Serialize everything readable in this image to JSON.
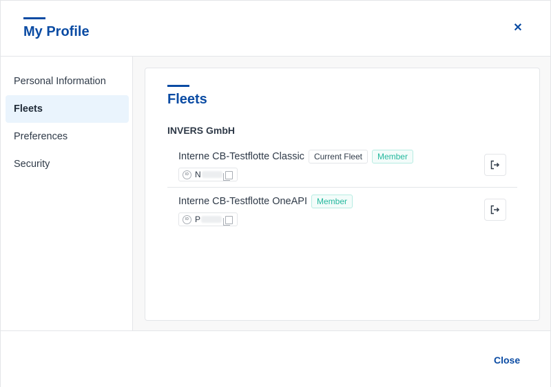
{
  "header": {
    "title": "My Profile",
    "close_icon": "close-icon",
    "close_glyph": "✕"
  },
  "sidebar": {
    "items": [
      {
        "label": "Personal Information",
        "active": false
      },
      {
        "label": "Fleets",
        "active": true
      },
      {
        "label": "Preferences",
        "active": false
      },
      {
        "label": "Security",
        "active": false
      }
    ]
  },
  "main": {
    "section_title": "Fleets",
    "organization": "INVERS GmbH",
    "fleets": [
      {
        "name": "Interne CB-Testflotte Classic",
        "badges": [
          "Current Fleet",
          "Member"
        ],
        "id_prefix": "N",
        "id_icon": "id-icon",
        "copy_icon": "copy-icon",
        "action_icon": "leave-fleet-icon"
      },
      {
        "name": "Interne CB-Testflotte OneAPI",
        "badges": [
          "Member"
        ],
        "id_prefix": "P",
        "id_icon": "id-icon",
        "copy_icon": "copy-icon",
        "action_icon": "leave-fleet-icon"
      }
    ],
    "id_icon_text": "ID"
  },
  "footer": {
    "close_label": "Close"
  },
  "colors": {
    "accent": "#0a4ba3",
    "member": "#23b89d",
    "active_bg": "#eaf4fd"
  }
}
